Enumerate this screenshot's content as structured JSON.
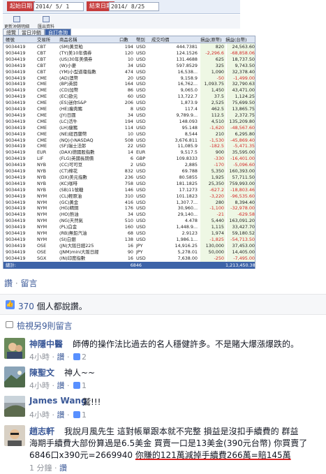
{
  "trade": {
    "btn_query": "起始日期",
    "date_start": "2014/ 5/ 1",
    "btn_end": "結束日期",
    "date_end": "2014/ 8/25",
    "tools": [
      "更新沖銷明細",
      "匯出資料"
    ],
    "tabs": [
      "總覽",
      "當日沖銷",
      "自訂查詢"
    ],
    "headers": [
      "帳號",
      "交易所",
      "商品名稱",
      "口數",
      "幣別",
      "成交均價",
      "損益(原幣)",
      "損益(台幣)"
    ],
    "rows": [
      [
        "9034419",
        "CBT",
        "(SM)黃豆粕",
        "194",
        "USD",
        "444.7381",
        "820",
        "24,563.60"
      ],
      [
        "9034419",
        "CBT",
        "(TY)美10年債券",
        "120",
        "USD",
        "124.1526",
        "-2,296.6",
        "-68,858.06"
      ],
      [
        "9034419",
        "CBT",
        "(US)30年美債券",
        "10",
        "USD",
        "131.4688",
        "625",
        "18,737.50"
      ],
      [
        "9034419",
        "CBT",
        "(W)小麥",
        "34",
        "USD",
        "597.8529",
        "325",
        "9,743.50"
      ],
      [
        "9034419",
        "CBT",
        "(YM)小型道瓊指數",
        "474",
        "USD",
        "16,538...",
        "1,090",
        "32,378.40"
      ],
      [
        "9034419",
        "CME",
        "(AD)澳幣",
        "20",
        "USD",
        "9,158.9",
        "-50",
        "-1,499.00"
      ],
      [
        "9034419",
        "CME",
        "(BP)英鎊",
        "164",
        "USD",
        "16,762...",
        "1,093.75",
        "32,790.63"
      ],
      [
        "9034419",
        "CME",
        "(CD)加幣",
        "86",
        "USD",
        "9,065.0",
        "1,450",
        "43,471.00"
      ],
      [
        "9034419",
        "CME",
        "(EC)歐元",
        "60",
        "USD",
        "13,722.7",
        "37.5",
        "1,124.25"
      ],
      [
        "9034419",
        "CME",
        "(ES)迷你S&P",
        "206",
        "USD",
        "1,873.9",
        "2,525",
        "75,699.50"
      ],
      [
        "9034419",
        "CME",
        "(HE)瘦肉豬",
        "8",
        "USD",
        "117.4",
        "462.5",
        "13,865.75"
      ],
      [
        "9034419",
        "CME",
        "(JY)日圓",
        "34",
        "USD",
        "9,789.9...",
        "112.5",
        "2,372.75"
      ],
      [
        "9034419",
        "CME",
        "(LC)活牛",
        "194",
        "USD",
        "148.093",
        "4,510",
        "135,209.80"
      ],
      [
        "9034419",
        "CME",
        "(LH)瘦豬",
        "114",
        "USD",
        "95.148",
        "-1,620",
        "-48,567.60"
      ],
      [
        "9034419",
        "CME",
        "(NE)紐西蘭幣",
        "10",
        "USD",
        "8,544",
        "210",
        "6,295.80"
      ],
      [
        "9034419",
        "CME",
        "(NQ)小NASDAQ",
        "508",
        "USD",
        "3,676.811",
        "-1,530",
        "-45,869.40"
      ],
      [
        "9034419",
        "CME",
        "(SF)瑞士法郎",
        "22",
        "USD",
        "11,085.9",
        "-182.5",
        "-5,471.35"
      ],
      [
        "9034419",
        "EUR",
        "(DAX)德國股指數",
        "14",
        "EUR",
        "9,517.5",
        "900",
        "35,595.00"
      ],
      [
        "9034419",
        "LIF",
        "(FLG)英國長期債",
        "6",
        "GBP",
        "109.8333",
        "-330",
        "-16,401.00"
      ],
      [
        "9034419",
        "NYB",
        "(CC)可可豆",
        "2",
        "USD",
        "2,885",
        "-170",
        "-5,096.60"
      ],
      [
        "9034419",
        "NYB",
        "(CT)棉花",
        "832",
        "USD",
        "69.788",
        "5,350",
        "160,393.00"
      ],
      [
        "9034419",
        "NYB",
        "(DX)美元指數",
        "236",
        "USD",
        "80.5855",
        "1,925",
        "57,711.50"
      ],
      [
        "9034419",
        "NYB",
        "(KC)咖啡",
        "758",
        "USD",
        "181.1825",
        "25,350",
        "759,993.00"
      ],
      [
        "9034419",
        "NYB",
        "(SB)11號糖",
        "146",
        "USD",
        "17.1273",
        "-627.2",
        "-18,803.46"
      ],
      [
        "9034419",
        "NYM",
        "(CL)輕原油",
        "310",
        "USD",
        "101.1823",
        "-3,220",
        "-96,535.60"
      ],
      [
        "9034419",
        "NYM",
        "(GC)黃金",
        "416",
        "USD",
        "1,307.7...",
        "280",
        "8,394.40"
      ],
      [
        "9034419",
        "NYM",
        "(HG)精銅",
        "176",
        "USD",
        "30,960...",
        "-1,100",
        "-32,978.00"
      ],
      [
        "9034419",
        "NYM",
        "(HO)熱油",
        "34",
        "USD",
        "29,140...",
        "-21",
        "-629.58"
      ],
      [
        "9034419",
        "NYM",
        "(NG)天然氣",
        "510",
        "USD",
        "4.478",
        "5,440",
        "163,091.20"
      ],
      [
        "9034419",
        "NYM",
        "(PL)白金",
        "160",
        "USD",
        "1,448.9...",
        "1,115",
        "33,427.70"
      ],
      [
        "9034419",
        "NYM",
        "(RB)無鉛汽油",
        "68",
        "USD",
        "2.9123",
        "1,974",
        "59,180.52"
      ],
      [
        "9034419",
        "NYM",
        "(SI)白銀",
        "138",
        "USD",
        "1,986.1...",
        "-1,825",
        "-54,713.50"
      ],
      [
        "9034419",
        "OSE",
        "(JN)大阪日經225",
        "16",
        "JPY",
        "14,916.25",
        "130,000",
        "37,453.00"
      ],
      [
        "9034419",
        "OSE",
        "(JNM)mini大阪日經",
        "90",
        "JPY",
        "5,278.01",
        "50,000",
        "14,405.00"
      ],
      [
        "9034419",
        "SGX",
        "(IN)印度指數",
        "16",
        "USD",
        "7,638.00",
        "-250",
        "-7,495.00"
      ]
    ],
    "total_label": "總計:",
    "total_qty": "6846",
    "total_twd": "1,213,450.38"
  },
  "fb": {
    "like_label": "讚",
    "sep": "·",
    "comment_label": "留言",
    "likes_count": "370",
    "likes_suffix": "個人都說讚。",
    "more_comments": "檢視另9則留言",
    "comments": [
      {
        "name": "神隱中醫",
        "text": "師傅的操作法比過去的名人穩健許多。不是賭大爆漲爆跌的。",
        "time": "4小時",
        "like": "讚",
        "likes": "2"
      },
      {
        "name": "陳聖文",
        "text": "神人~~",
        "time": "4小時",
        "like": "讚",
        "likes": "1"
      },
      {
        "name": "James Wang",
        "text": "鷲!!!",
        "time": "4小時",
        "like": "讚",
        "likes": "1"
      },
      {
        "name": "趙志軒",
        "line1": "我說月風先生 這對帳單跟本就不完整 損益是沒扣手續費的 群益",
        "line2": "海期手續費大部份算過是6.5美金 買賣一口是13美金(390元台幣) 你買賣了",
        "line3a": "6846口x390元=2669940 ",
        "line3b": "你賺的121萬減掉手續費266萬=賠145萬",
        "time": "1 分鐘",
        "like": "讚"
      }
    ]
  }
}
